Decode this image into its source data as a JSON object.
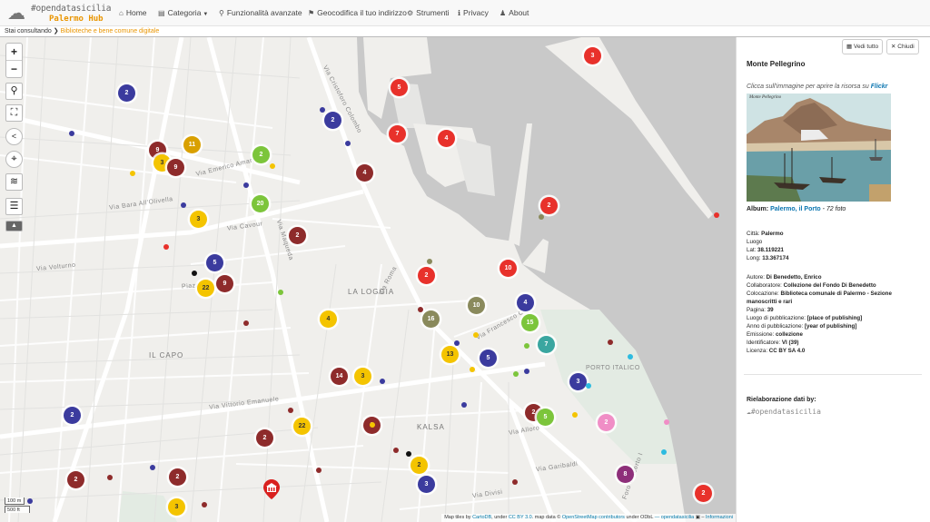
{
  "app": {
    "brand": "#opendatasicilia",
    "hub": "Palermo Hub"
  },
  "nav": {
    "home": "Home",
    "categoria": "Categoria",
    "funzionalita": "Funzionalità avanzate",
    "geocodifica": "Geocodifica il tuo indirizzo",
    "strumenti": "Strumenti",
    "privacy": "Privacy",
    "about": "About"
  },
  "breadcrumb": {
    "prefix": "Stai consultando",
    "current": "Biblioteche e bene comune digitale"
  },
  "map": {
    "labels": {
      "la_loggia": "LA LOGGIA",
      "il_capo": "IL CAPO",
      "kalsa": "KALSA",
      "porto_italico": "PORTO ITALICO",
      "via_amari": "Via Emerico Amari",
      "via_roma": "Via Roma",
      "via_crispi": "Via Francesco Crispi",
      "via_colonna": "Via Cristoforo Colombo",
      "foro": "Foro Umberto I",
      "via_maqueda": "Via Maqueda",
      "via_vittorio": "Via Vittorio Emanuele",
      "via_cavour": "Via Cavour",
      "via_volturno": "Via Volturno",
      "via_alloro": "Via Alloro",
      "via_divisi": "Via Divisi",
      "via_garibaldi": "Via Garibaldi",
      "via_bara": "Via Bara All'Olivella",
      "piazza_verdi": "Piazza Verdi"
    },
    "scale": {
      "meters": "100 m",
      "feet": "500 ft"
    },
    "attribution": {
      "prefix": "Map tiles by",
      "carto": "CartoDB",
      "under": ", under",
      "ccby": "CC BY 3.0",
      "mapdata": ". map data ©",
      "osm": "OpenStreetMap contributors",
      "odbl": "under ODbL",
      "ods": "— opendatasicilia",
      "info": "Informazioni"
    },
    "colors": {
      "red": "#e8312b",
      "darkred": "#8e2b2b",
      "navy": "#3b3b9e",
      "yellow": "#f4c400",
      "olive": "#8a8a5c",
      "green": "#7cc53b",
      "teal": "#3aa6a0",
      "cyan": "#2dbbe0",
      "purple": "#8e2f7a",
      "pink": "#f08ec6"
    },
    "clusters": [
      {
        "label": "3",
        "color": "#e8312b"
      },
      {
        "label": "5",
        "color": "#e8312b"
      },
      {
        "label": "2",
        "color": "#3b3b9e"
      },
      {
        "label": "7",
        "color": "#e8312b"
      },
      {
        "label": "4",
        "color": "#e8312b"
      },
      {
        "label": "2",
        "color": "#3b3b9e"
      },
      {
        "label": "9",
        "color": "#8e2b2b"
      },
      {
        "label": "11",
        "color": "#d9a000"
      },
      {
        "label": "3",
        "color": "#f4c400"
      },
      {
        "label": "9",
        "color": "#8e2b2b"
      },
      {
        "label": "2",
        "color": "#7cc53b"
      },
      {
        "label": "4",
        "color": "#8e2b2b"
      },
      {
        "label": "20",
        "color": "#7cc53b"
      },
      {
        "label": "2",
        "color": "#e8312b"
      },
      {
        "label": "3",
        "color": "#f4c400"
      },
      {
        "label": "2",
        "color": "#8e2b2b"
      },
      {
        "label": "5",
        "color": "#3b3b9e"
      },
      {
        "label": "22",
        "color": "#f4c400"
      },
      {
        "label": "9",
        "color": "#8e2b2b"
      },
      {
        "label": "2",
        "color": "#e8312b"
      },
      {
        "label": "10",
        "color": "#e8312b"
      },
      {
        "label": "10",
        "color": "#8a8a5c"
      },
      {
        "label": "4",
        "color": "#3b3b9e"
      },
      {
        "label": "16",
        "color": "#8a8a5c"
      },
      {
        "label": "4",
        "color": "#f4c400"
      },
      {
        "label": "15",
        "color": "#7cc53b"
      },
      {
        "label": "7",
        "color": "#3aa6a0"
      },
      {
        "label": "13",
        "color": "#f4c400"
      },
      {
        "label": "5",
        "color": "#3b3b9e"
      },
      {
        "label": "3",
        "color": "#3b3b9e"
      },
      {
        "label": "14",
        "color": "#8e2b2b"
      },
      {
        "label": "3",
        "color": "#f4c400"
      },
      {
        "label": "2",
        "color": "#3b3b9e"
      },
      {
        "label": "2",
        "color": "#8e2b2b"
      },
      {
        "label": "5",
        "color": "#7cc53b"
      },
      {
        "label": "2",
        "color": "#f08ec6"
      },
      {
        "label": "22",
        "color": "#f4c400"
      },
      {
        "label": "2",
        "color": "#8e2b2b"
      },
      {
        "label": "2",
        "color": "#8e2b2b"
      },
      {
        "label": "2",
        "color": "#f4c400"
      },
      {
        "label": "3",
        "color": "#3b3b9e"
      },
      {
        "label": "8",
        "color": "#8e2f7a"
      },
      {
        "label": "2",
        "color": "#8e2b2b"
      },
      {
        "label": "2",
        "color": "#8e2b2b"
      },
      {
        "label": "3",
        "color": "#f4c400"
      },
      {
        "label": "2",
        "color": "#e8312b"
      }
    ]
  },
  "panel": {
    "vedi_tutto": "Vedi tutto",
    "chiudi": "Chiudi",
    "title": "Monte Pellegrino",
    "note_prefix": "Clicca sull'immagine per aprire la risorsa su",
    "note_link": "Flickr",
    "photo_caption": "Monte Pellegrino",
    "album_prefix": "Album:",
    "album_link": "Palermo, il Porto",
    "album_suffix": "- 72 foto",
    "fields_a": [
      {
        "k": "Città:",
        "v": "Palermo"
      },
      {
        "k": "Luogo",
        "v": ""
      },
      {
        "k": "Lat:",
        "v": "38.119221"
      },
      {
        "k": "Long:",
        "v": "13.367174"
      }
    ],
    "fields_b": [
      {
        "k": "Autore:",
        "v": "Di Benedetto, Enrico"
      },
      {
        "k": "Collaboratore:",
        "v": "Collezione del Fondo Di Benedetto"
      },
      {
        "k": "Colocazione:",
        "v": "Biblioteca comunale di Palermo - Sezione"
      },
      {
        "k": "",
        "v": "manoscritti e rari"
      },
      {
        "k": "Pagina:",
        "v": "39"
      },
      {
        "k": "Luogo di pubblicazione:",
        "v": "[place of publishing]"
      },
      {
        "k": "Anno di pubblicazione:",
        "v": "[year of publishing]"
      },
      {
        "k": "Emissione:",
        "v": "collezione"
      },
      {
        "k": "Identificatore:",
        "v": "VI (39)"
      },
      {
        "k": "Licenza:",
        "v": "CC BY SA 4.0"
      }
    ],
    "credit_heading": "Rielaborazione dati by:",
    "credit_logo": "#opendatasicilia"
  }
}
